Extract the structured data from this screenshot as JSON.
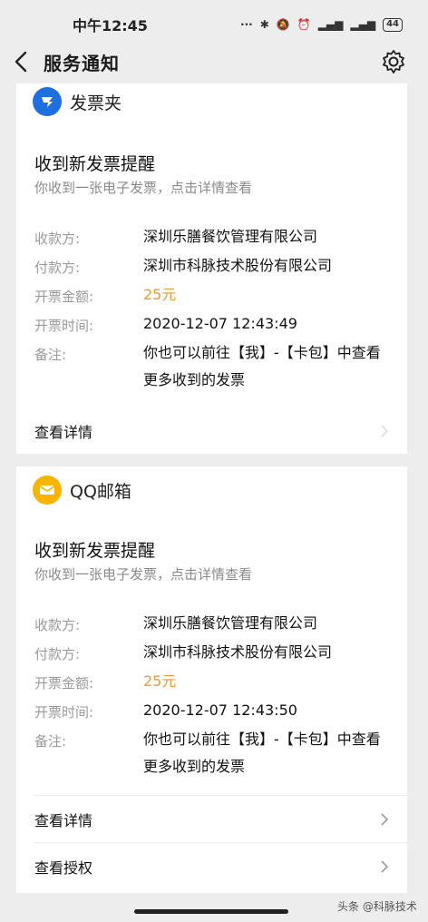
{
  "status_bar": {
    "time": "中午12:45",
    "battery": "44"
  },
  "nav": {
    "title": "服务通知"
  },
  "cards": [
    {
      "app_name": "发票夹",
      "title": "收到新发票提醒",
      "subtitle": "你收到一张电子发票，点击详情查看",
      "rows": [
        {
          "label": "收款方:",
          "value": "深圳乐膳餐饮管理有限公司"
        },
        {
          "label": "付款方:",
          "value": "深圳市科脉技术股份有限公司"
        },
        {
          "label": "开票金额:",
          "value": "25元"
        },
        {
          "label": "开票时间:",
          "value": "2020-12-07 12:43:49"
        },
        {
          "label": "备注:",
          "value": "你也可以前往【我】-【卡包】中查看更多收到的发票"
        }
      ],
      "links": [
        "查看详情"
      ]
    },
    {
      "app_name": "QQ邮箱",
      "title": "收到新发票提醒",
      "subtitle": "你收到一张电子发票，点击详情查看",
      "rows": [
        {
          "label": "收款方:",
          "value": "深圳乐膳餐饮管理有限公司"
        },
        {
          "label": "付款方:",
          "value": "深圳市科脉技术股份有限公司"
        },
        {
          "label": "开票金额:",
          "value": "25元"
        },
        {
          "label": "开票时间:",
          "value": "2020-12-07 12:43:50"
        },
        {
          "label": "备注:",
          "value": "你也可以前往【我】-【卡包】中查看更多收到的发票"
        }
      ],
      "links": [
        "查看详情",
        "查看授权"
      ]
    }
  ],
  "watermark": "头条 @科脉技术",
  "colors": {
    "background": "#ededed",
    "amount": "#e89a3c",
    "fapiaojia_logo": "#1f6fe0",
    "qqmail_logo": "#f7b500"
  }
}
